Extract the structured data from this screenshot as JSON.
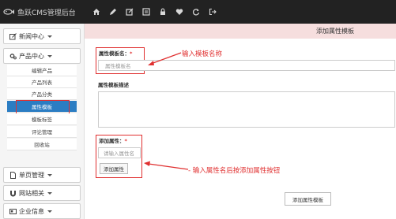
{
  "app": {
    "title": "鱼跃CMS管理后台"
  },
  "toolbar": {
    "icons": [
      "home-icon",
      "pencil-icon",
      "edit-icon",
      "list-icon",
      "lock-icon",
      "heart-icon",
      "refresh-icon",
      "logout-icon"
    ]
  },
  "sidebar": {
    "groups": [
      {
        "label": "新闻中心",
        "icon": "edit-icon"
      },
      {
        "label": "产品中心",
        "icon": "cogs-icon"
      },
      {
        "label": "单页管理",
        "icon": "file-icon"
      },
      {
        "label": "网站相关",
        "icon": "magnet-icon"
      },
      {
        "label": "企业信息",
        "icon": "card-icon"
      }
    ],
    "items": [
      "编辑产品",
      "产品列表",
      "产品分类",
      "属性模板",
      "模板标签",
      "评论管理",
      "回收站"
    ],
    "active_item": "属性模板"
  },
  "page": {
    "header": "添加属性模板",
    "template_name_label": "属性模板名：",
    "required_mark": "*",
    "template_name_placeholder": "属性模板名",
    "description_label": "属性模板描述",
    "add_attribute_label": "添加属性：",
    "attribute_name_placeholder": "请输入属性名",
    "add_attribute_button": "添加属性",
    "submit_button": "添加属性模板"
  },
  "annotations": {
    "name_hint": "输入模板名称",
    "attribute_hint": "输入属性名后按添加属性按钮"
  },
  "colors": {
    "topbar": "#222222",
    "header_bg": "#f6dede",
    "active_item": "#2b7dc3",
    "annotation_red": "#e03030"
  }
}
